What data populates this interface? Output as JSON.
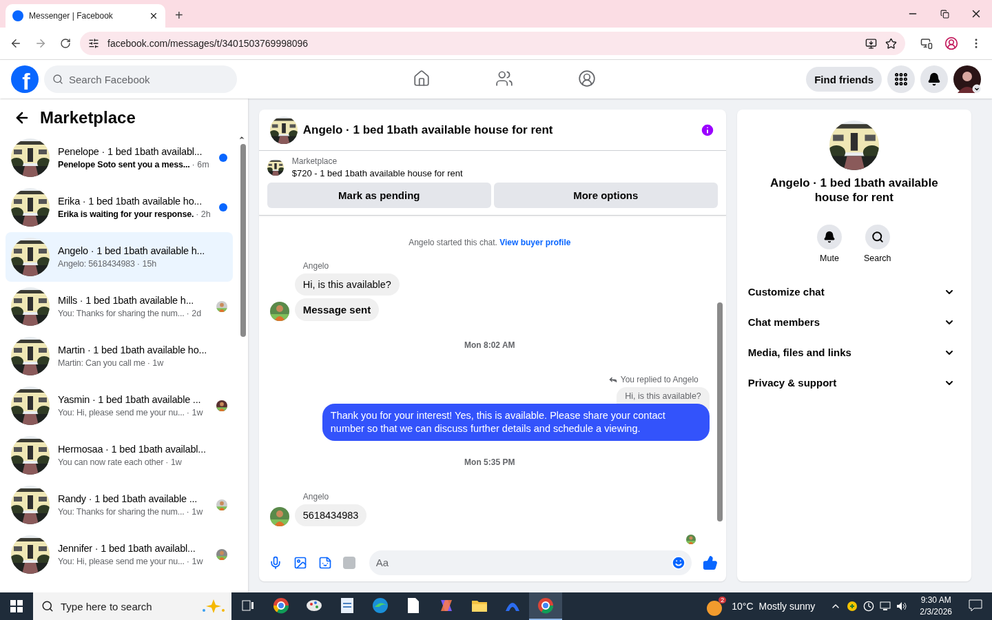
{
  "browser": {
    "tab_title": "Messenger | Facebook",
    "new_tab": "+",
    "url": "facebook.com/messages/t/3401503769998096"
  },
  "header": {
    "logo": "f",
    "search_placeholder": "Search Facebook",
    "nav": [
      {
        "kind": "home",
        "selected": false
      },
      {
        "kind": "friends",
        "selected": false
      },
      {
        "kind": "groups",
        "selected": false
      }
    ],
    "find_friends": "Find friends"
  },
  "sidebar": {
    "title": "Marketplace",
    "conversations": [
      {
        "title": "Penelope · 1 bed 1bath availabl...",
        "preview": "Penelope Soto sent you a mess...",
        "time": "· 6m",
        "unread": true,
        "selected": false,
        "seen": false
      },
      {
        "title": "Erika · 1 bed 1bath available ho...",
        "preview": "Erika is waiting for your response.",
        "time": "· 2h",
        "unread": true,
        "selected": false,
        "seen": false
      },
      {
        "title": "Angelo · 1 bed 1bath available h...",
        "preview": "Angelo: 5618434983",
        "time": "· 15h",
        "unread": false,
        "selected": true,
        "seen": false
      },
      {
        "title": "Mills · 1 bed 1bath available h...",
        "preview": "You: Thanks for sharing the num...",
        "time": "· 2d",
        "unread": false,
        "selected": false,
        "seen": true
      },
      {
        "title": "Martin · 1 bed 1bath available ho...",
        "preview": "Martin: Can you call me",
        "time": "· 1w",
        "unread": false,
        "selected": false,
        "seen": false
      },
      {
        "title": "Yasmin · 1 bed 1bath available ...",
        "preview": "You: Hi, please send me your nu...",
        "time": "· 1w",
        "unread": false,
        "selected": false,
        "seen": true
      },
      {
        "title": "Hermosaa · 1 bed 1bath availabl...",
        "preview": "You can now rate each other",
        "time": "· 1w",
        "unread": false,
        "selected": false,
        "seen": false
      },
      {
        "title": "Randy · 1 bed 1bath available ...",
        "preview": "You: Thanks for sharing the num...",
        "time": "· 1w",
        "unread": false,
        "selected": false,
        "seen": true
      },
      {
        "title": "Jennifer · 1 bed 1bath availabl...",
        "preview": "You: Hi, please send me your nu...",
        "time": "· 1w",
        "unread": false,
        "selected": false,
        "seen": true
      }
    ]
  },
  "chat": {
    "title": "Angelo · 1 bed 1bath available house for rent",
    "listing": {
      "label": "Marketplace",
      "description": "$720 - 1 bed 1bath available house for rent"
    },
    "actions": [
      "Mark as pending",
      "More options"
    ],
    "intro": {
      "text": "Angelo started this chat.",
      "link": "View buyer profile"
    },
    "messages": [
      {
        "kind": "sender",
        "text": "Angelo"
      },
      {
        "kind": "incoming",
        "text": "Hi, is this available?",
        "avatar": false
      },
      {
        "kind": "incoming-bold",
        "text": "Message sent",
        "avatar": true
      },
      {
        "kind": "time",
        "text": "Mon 8:02 AM"
      },
      {
        "kind": "reply-note",
        "text": "You replied to Angelo"
      },
      {
        "kind": "quote",
        "text": "Hi, is this available?"
      },
      {
        "kind": "outgoing",
        "text": "Thank you for your interest! Yes, this is available. Please share your contact number so that we can discuss further details and schedule a viewing."
      },
      {
        "kind": "time",
        "text": "Mon 5:35 PM"
      },
      {
        "kind": "sender",
        "text": "Angelo"
      },
      {
        "kind": "incoming",
        "text": "5618434983",
        "avatar": true
      },
      {
        "kind": "seen"
      }
    ],
    "composer": {
      "placeholder": "Aa"
    }
  },
  "details": {
    "title": "Angelo · 1 bed 1bath available house for rent",
    "actions": [
      {
        "kind": "mute",
        "label": "Mute"
      },
      {
        "kind": "search",
        "label": "Search"
      }
    ],
    "sections": [
      "Customize chat",
      "Chat members",
      "Media, files and links",
      "Privacy & support"
    ]
  },
  "taskbar": {
    "search_placeholder": "Type here to search",
    "weather": {
      "badge": "2",
      "temp": "10°C",
      "condition": "Mostly sunny"
    },
    "time": "9:30 AM",
    "date": "2/3/2026"
  }
}
